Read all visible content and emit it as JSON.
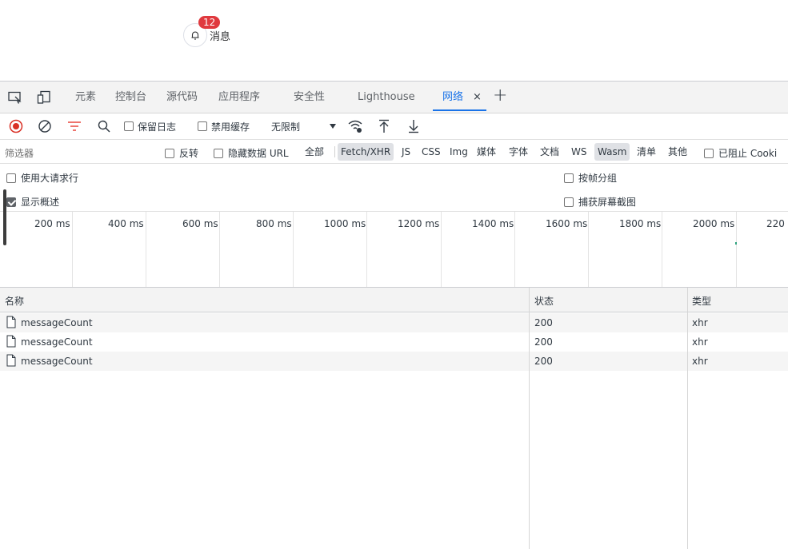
{
  "page": {
    "badge_count": "12",
    "message_label": "消息",
    "bell_icon": "bell-icon"
  },
  "devtools": {
    "tabs": [
      {
        "label": "元素"
      },
      {
        "label": "控制台"
      },
      {
        "label": "源代码"
      },
      {
        "label": "应用程序"
      },
      {
        "label": "安全性"
      },
      {
        "label": "Lighthouse"
      },
      {
        "label": "网络",
        "active": true
      }
    ],
    "tab_close": "×",
    "tab_add": "+",
    "toolbar": {
      "preserve_log": "保留日志",
      "disable_cache": "禁用缓存",
      "throttle_value": "无限制"
    },
    "filter": {
      "placeholder": "筛选器",
      "invert": "反转",
      "hide_data_url": "隐藏数据 URL",
      "types": [
        "全部",
        "Fetch/XHR",
        "JS",
        "CSS",
        "Img",
        "媒体",
        "字体",
        "文档",
        "WS",
        "Wasm",
        "清单",
        "其他"
      ],
      "selected_types": [
        "Fetch/XHR",
        "Wasm"
      ],
      "blocked_cookies": "已阻止 Cooki"
    },
    "options": {
      "large_rows": "使用大请求行",
      "show_overview": "显示概述",
      "show_overview_checked": true,
      "group_by_frame": "按帧分组",
      "capture_screenshots": "捕获屏幕截图"
    },
    "overview_ticks": [
      "200 ms",
      "400 ms",
      "600 ms",
      "800 ms",
      "1000 ms",
      "1200 ms",
      "1400 ms",
      "1600 ms",
      "1800 ms",
      "2000 ms",
      "220"
    ],
    "table": {
      "columns": [
        "名称",
        "状态",
        "类型"
      ],
      "rows": [
        {
          "name": "messageCount",
          "status": "200",
          "type": "xhr"
        },
        {
          "name": "messageCount",
          "status": "200",
          "type": "xhr"
        },
        {
          "name": "messageCount",
          "status": "200",
          "type": "xhr"
        }
      ]
    },
    "accent_color": "#1a73e8",
    "record_color": "#d93025"
  }
}
